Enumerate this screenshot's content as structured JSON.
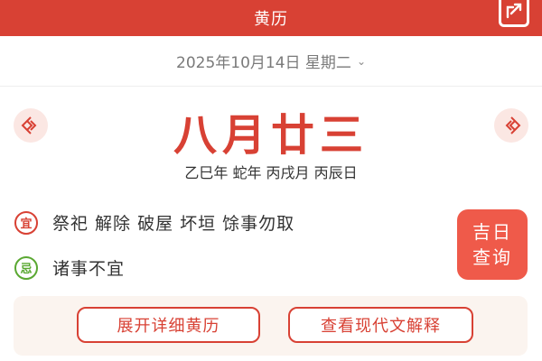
{
  "header": {
    "title": "黄历",
    "share_icon": "share-icon"
  },
  "date_selector": {
    "date": "2025年10月14日 星期二",
    "chevron": "⌄"
  },
  "lunar": {
    "date": "八月廿三",
    "ganzhi": "乙巳年 蛇年 丙戌月 丙辰日"
  },
  "nav": {
    "prev_icon": "knot-left-icon",
    "next_icon": "knot-right-icon"
  },
  "yi": {
    "badge": "宜",
    "text": "祭祀 解除 破屋 坏垣 馀事勿取"
  },
  "ji": {
    "badge": "忌",
    "text": "诸事不宜"
  },
  "jiri_button": {
    "line1": "吉日",
    "line2": "查询"
  },
  "actions": {
    "expand_label": "展开详细黄历",
    "modern_label": "查看现代文解释"
  },
  "colors": {
    "primary": "#d84134",
    "accent_button": "#ef5a4a",
    "ji_green": "#5aa832",
    "panel_bg": "#fbf4ef"
  }
}
